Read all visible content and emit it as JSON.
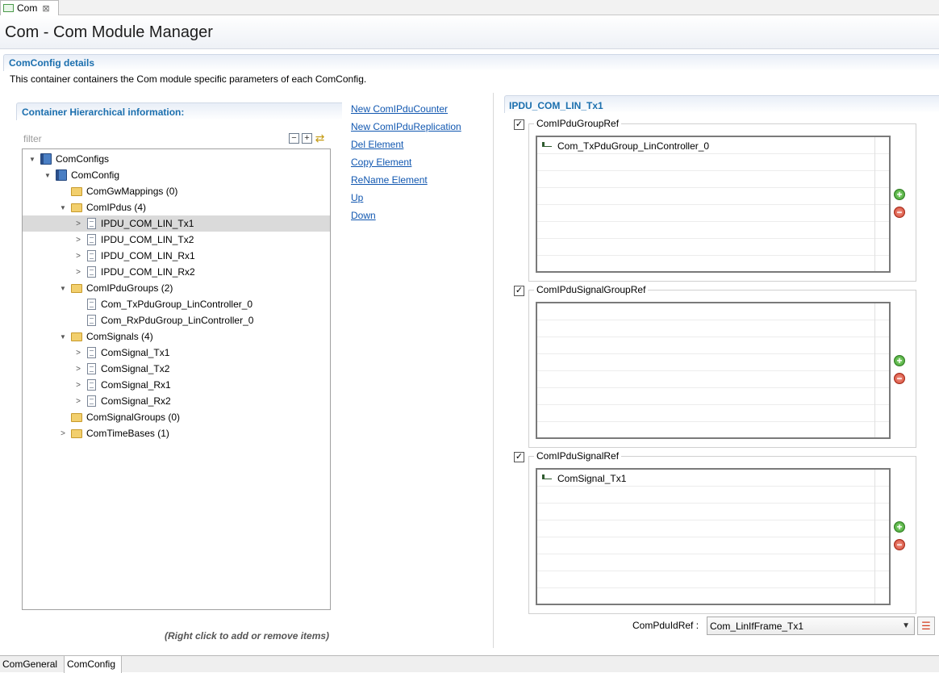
{
  "editor_tab": {
    "label": "Com",
    "close": "⊠"
  },
  "header": {
    "title": "Com - Com Module Manager"
  },
  "section": {
    "title": "ComConfig details",
    "description": "This container containers the Com module specific parameters of each ComConfig."
  },
  "left": {
    "title": "Container Hierarchical information:",
    "filter_placeholder": "filter",
    "tree": [
      {
        "label": "ComConfigs",
        "indent": 0,
        "twisty": "expanded",
        "icon": "book",
        "selected": false
      },
      {
        "label": "ComConfig",
        "indent": 1,
        "twisty": "expanded",
        "icon": "book",
        "selected": false
      },
      {
        "label": "ComGwMappings (0)",
        "indent": 2,
        "twisty": "none",
        "icon": "folder",
        "selected": false
      },
      {
        "label": "ComIPdus (4)",
        "indent": 2,
        "twisty": "expanded",
        "icon": "folder",
        "selected": false
      },
      {
        "label": "IPDU_COM_LIN_Tx1",
        "indent": 3,
        "twisty": "collapsed",
        "icon": "doc",
        "selected": true
      },
      {
        "label": "IPDU_COM_LIN_Tx2",
        "indent": 3,
        "twisty": "collapsed",
        "icon": "doc",
        "selected": false
      },
      {
        "label": "IPDU_COM_LIN_Rx1",
        "indent": 3,
        "twisty": "collapsed",
        "icon": "doc",
        "selected": false
      },
      {
        "label": "IPDU_COM_LIN_Rx2",
        "indent": 3,
        "twisty": "collapsed",
        "icon": "doc",
        "selected": false
      },
      {
        "label": "ComIPduGroups (2)",
        "indent": 2,
        "twisty": "expanded",
        "icon": "folder",
        "selected": false
      },
      {
        "label": "Com_TxPduGroup_LinController_0",
        "indent": 3,
        "twisty": "none",
        "icon": "doc",
        "selected": false
      },
      {
        "label": "Com_RxPduGroup_LinController_0",
        "indent": 3,
        "twisty": "none",
        "icon": "doc",
        "selected": false
      },
      {
        "label": "ComSignals (4)",
        "indent": 2,
        "twisty": "expanded",
        "icon": "folder",
        "selected": false
      },
      {
        "label": "ComSignal_Tx1",
        "indent": 3,
        "twisty": "collapsed",
        "icon": "doc",
        "selected": false
      },
      {
        "label": "ComSignal_Tx2",
        "indent": 3,
        "twisty": "collapsed",
        "icon": "doc",
        "selected": false
      },
      {
        "label": "ComSignal_Rx1",
        "indent": 3,
        "twisty": "collapsed",
        "icon": "doc",
        "selected": false
      },
      {
        "label": "ComSignal_Rx2",
        "indent": 3,
        "twisty": "collapsed",
        "icon": "doc",
        "selected": false
      },
      {
        "label": "ComSignalGroups (0)",
        "indent": 2,
        "twisty": "none",
        "icon": "folder",
        "selected": false
      },
      {
        "label": "ComTimeBases (1)",
        "indent": 2,
        "twisty": "collapsed",
        "icon": "folder",
        "selected": false
      }
    ],
    "hint": "(Right click to add or remove items)"
  },
  "actions": [
    "New ComIPduCounter",
    "New ComIPduReplication",
    "Del Element",
    "Copy Element",
    "ReName Element",
    "Up",
    "Down"
  ],
  "right": {
    "title": "IPDU_COM_LIN_Tx1",
    "groups": [
      {
        "label": "ComIPduGroupRef",
        "checked": true,
        "items": [
          "Com_TxPduGroup_LinController_0"
        ]
      },
      {
        "label": "ComIPduSignalGroupRef",
        "checked": true,
        "items": []
      },
      {
        "label": "ComIPduSignalRef",
        "checked": true,
        "items": [
          "ComSignal_Tx1"
        ]
      }
    ],
    "pdu_id_ref": {
      "label": "ComPduIdRef :",
      "value": "Com_LinIfFrame_Tx1"
    }
  },
  "page_tabs": [
    "ComGeneral",
    "ComConfig"
  ],
  "active_page_tab": "ComConfig",
  "colors": {
    "section_title": "#1b6fae",
    "link": "#1157b0",
    "selection": "#dadada"
  }
}
